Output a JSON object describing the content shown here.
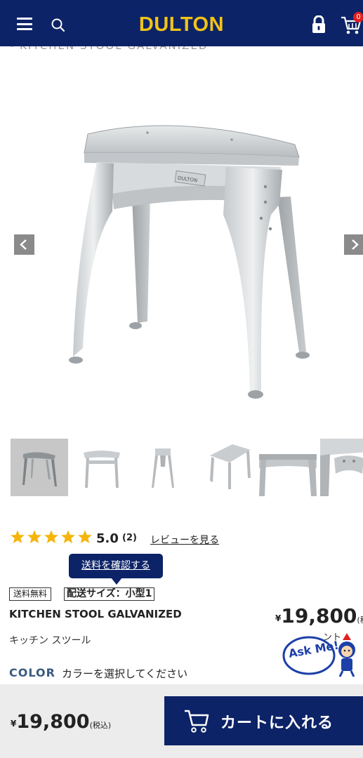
{
  "header": {
    "logo": "DULTON",
    "cart_count": "0",
    "menu_icon": "hamburger-icon",
    "search_icon": "search-icon",
    "lock_icon": "lock-icon",
    "cart_icon": "cart-icon"
  },
  "hero": {
    "cut_off_text": "- KITCHEN STOOL GALVANIZED",
    "stool_plate_text": "DULTON",
    "prev_icon": "chevron-left-icon",
    "next_icon": "chevron-right-icon",
    "thumbnail_count": 6
  },
  "rating": {
    "stars": 5,
    "score": "5.0",
    "count": "(2)",
    "review_link": "レビューを見る",
    "star_color": "#f5b50a"
  },
  "shipping_tooltip": "送料を確認する",
  "tags": {
    "free_shipping": "送料無料",
    "shipping_size": "配送サイズ：小型1"
  },
  "product": {
    "name": "KITCHEN STOOL GALVANIZED",
    "name_jp": "キッチン スツール",
    "price_symbol": "¥",
    "price": "19,800",
    "tax_label": "(税込)",
    "price_tax_cut": "(税"
  },
  "ask_me": {
    "text": "Ask Me!",
    "peek_text": "ント"
  },
  "color": {
    "label": "COLOR",
    "prompt": "カラーを選択してください"
  },
  "bottom_bar": {
    "price_symbol": "¥",
    "price": "19,800",
    "tax_label": "(税込)",
    "cart_button_label": "カートに入れる",
    "cart_button_icon": "cart-icon"
  },
  "colors": {
    "navy": "#0d2367",
    "logo_yellow": "#f2c318",
    "badge_red": "#e01f1f",
    "color_label": "#3a5a80"
  }
}
